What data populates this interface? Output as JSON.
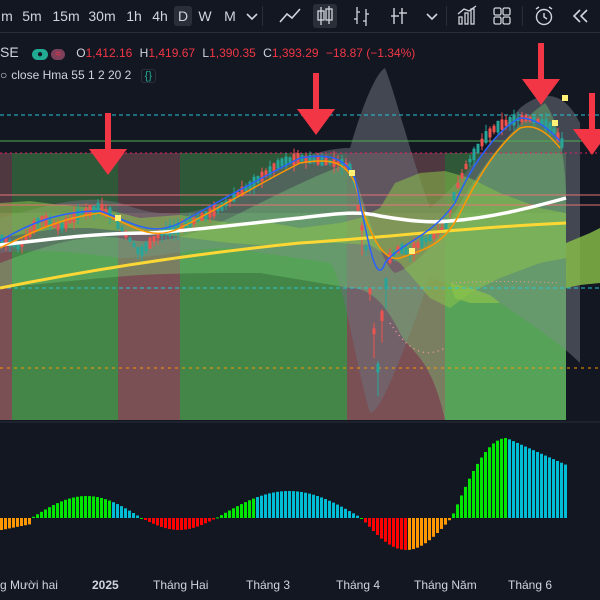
{
  "toolbar": {
    "timeframes": [
      {
        "label": "m",
        "active": false
      },
      {
        "label": "5m",
        "active": false
      },
      {
        "label": "15m",
        "active": false
      },
      {
        "label": "30m",
        "active": false
      },
      {
        "label": "1h",
        "active": false
      },
      {
        "label": "4h",
        "active": false
      },
      {
        "label": "D",
        "active": true
      },
      {
        "label": "W",
        "active": false
      },
      {
        "label": "M",
        "active": false
      }
    ]
  },
  "legend": {
    "symbol": "SE",
    "open_label": "O",
    "open": "1,412.16",
    "high_label": "H",
    "high": "1,419.67",
    "low_label": "L",
    "low": "1,390.35",
    "close_label": "C",
    "close": "1,393.29",
    "change": "−18.87 (−1.34%)",
    "indicator": "close Hma 55 1 2 20 2",
    "collapse_glyph": "{}"
  },
  "xaxis": {
    "labels": [
      "g Mười hai",
      "2025",
      "Tháng Hai",
      "Tháng 3",
      "Tháng 4",
      "Tháng Năm",
      "Tháng 6"
    ]
  },
  "colors": {
    "background": "#131722",
    "bull": "#26a69a",
    "bear": "#ef5350",
    "arrow": "#f23645",
    "hist_green": "#00e600",
    "hist_cyan": "#00bcd4",
    "hist_red": "#ff0000",
    "hist_orange": "#ff9800"
  }
}
